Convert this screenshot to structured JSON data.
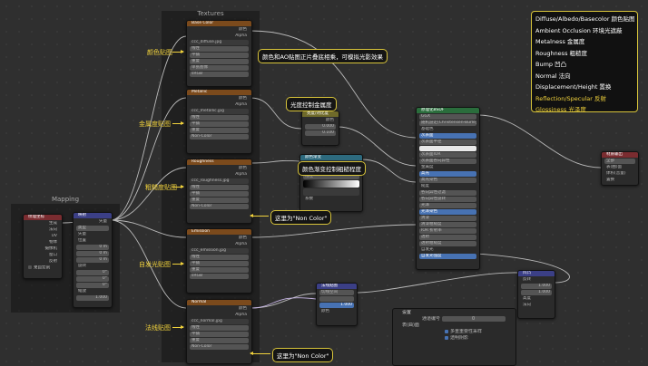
{
  "frames": {
    "textures_title": "Textures",
    "mapping_title": "Mapping"
  },
  "legend": [
    {
      "text": "Diffuse/Albedo/Basecolor 颜色贴图",
      "highlight": false
    },
    {
      "text": "Ambient Occlusion 环境光遮蔽",
      "highlight": false
    },
    {
      "text": "Metalness 金属度",
      "highlight": false
    },
    {
      "text": "Roughness 粗糙度",
      "highlight": false
    },
    {
      "text": "Bump 凹凸",
      "highlight": false
    },
    {
      "text": "Normal 法向",
      "highlight": false
    },
    {
      "text": "Displacement/Height 置换",
      "highlight": false
    },
    {
      "text": "Reflection/Specular 反射",
      "highlight": true
    },
    {
      "text": "Glossiness 光泽度",
      "highlight": true
    }
  ],
  "side_labels": {
    "color": "颜色贴图",
    "metal": "金属度贴图",
    "rough": "粗糙度贴图",
    "emission": "自发光贴图",
    "normal": "法线贴图"
  },
  "annotations": {
    "ao_mix": "颜色和AO贴图正片叠底相乘，可模拟光影效果",
    "metal_ctrl": "光度控制金属度",
    "rough_ctrl": "颜色渐变控制粗糙程度",
    "noncolor1": "这里为\"Non Color\"",
    "noncolor2": "这里为\"Non Color\""
  },
  "nodes": {
    "tex1": {
      "title": "Base Color",
      "file": "ccc_diffuse.jpg",
      "cs": "sRGB"
    },
    "tex2": {
      "title": "Metallic",
      "file": "ccc_metallic.jpg",
      "cs": "Non-Color"
    },
    "tex3": {
      "title": "Roughness",
      "file": "ccc_roughness.jpg",
      "cs": "Non-Color"
    },
    "tex4": {
      "title": "Emission",
      "file": "ccc_emission.jpg",
      "cs": "sRGB"
    },
    "tex5": {
      "title": "Normal",
      "file": "ccc_normal.jpg",
      "cs": "Non-Color"
    },
    "tex_rows": [
      "颜色",
      "Alpha",
      "线性",
      "平铺",
      "重复",
      "单张图像",
      "色彩空间"
    ],
    "texcoord": {
      "title": "纹理坐标",
      "outputs": [
        "生成",
        "法向",
        "UV",
        "物体",
        "摄像机",
        "窗口",
        "反射"
      ],
      "from_instancer": "来自实例"
    },
    "mapping": {
      "title": "映射",
      "type": "矢量",
      "rows": [
        "类型",
        "矢量",
        "位置",
        "X",
        "Y",
        "Z",
        "旋转",
        "X",
        "Y",
        "Z",
        "缩放",
        "X",
        "Y",
        "Z"
      ],
      "vals": [
        "0 m",
        "0 m",
        "0 m",
        "0°",
        "0°",
        "0°",
        "1.000",
        "1.000",
        "1.000"
      ]
    },
    "gamma": {
      "title": "亮度/对比度",
      "rows": [
        "颜色",
        "亮度",
        "对比度"
      ],
      "vals": [
        "0.000",
        "0.100"
      ]
    },
    "ramp": {
      "title": "颜色渐变",
      "mode": "线性",
      "rows": [
        "颜色",
        "Alpha",
        "系数"
      ]
    },
    "bsdf": {
      "title": "原理化BSDF",
      "dist": "GGX",
      "ss": "随机游走(Christensen-Burley)",
      "rows": [
        "基础色",
        "次表面",
        "次表面半径",
        "次表面颜色",
        "次表面IOR",
        "次表面各向异性",
        "金属度",
        "高光",
        "高光染色",
        "糙度",
        "各向异性过滤",
        "各向异性旋转",
        "光泽",
        "光泽染色",
        "清漆",
        "清漆粗糙度",
        "IOR 折射率",
        "透射",
        "透射粗糙度",
        "自发光",
        "自发光强度",
        "Alpha",
        "法线",
        "清漆法线",
        "切线"
      ],
      "vals": [
        "0.000",
        "",
        "",
        "1.400",
        "0.000",
        "",
        "0.500",
        "0.000",
        "",
        "0.000",
        "0.000",
        "0.000",
        "0.500",
        "0.000",
        "0.030",
        "1.450",
        "0.000",
        "0.000",
        "",
        "1.000",
        "1.000"
      ]
    },
    "output": {
      "title": "材质输出",
      "target": "全部",
      "rows": [
        "表(曲)面",
        "体积(音量)",
        "置换"
      ]
    },
    "normalmap": {
      "title": "法线贴图",
      "space": "切线空间",
      "rows": [
        "强度",
        "颜色"
      ],
      "val": "1.000"
    },
    "bump": {
      "title": "凹凸",
      "rows": [
        "反转",
        "强度",
        "距离",
        "高度",
        "法向"
      ],
      "vals": [
        "1.000",
        "1.000"
      ]
    },
    "settings": {
      "title": "设置",
      "pass": "通道编号",
      "pass_val": "0",
      "section": "表(曲)面",
      "opt1": "多重重要性采样",
      "opt2": "透明阴影"
    }
  },
  "colors": {
    "accent": "#f1d23c",
    "tex_header": "#7b4a1c",
    "shader_header": "#2a6d3c",
    "output_header": "#7a2c30",
    "vector_header": "#3b3f86",
    "wire": "#b9b9b9"
  }
}
